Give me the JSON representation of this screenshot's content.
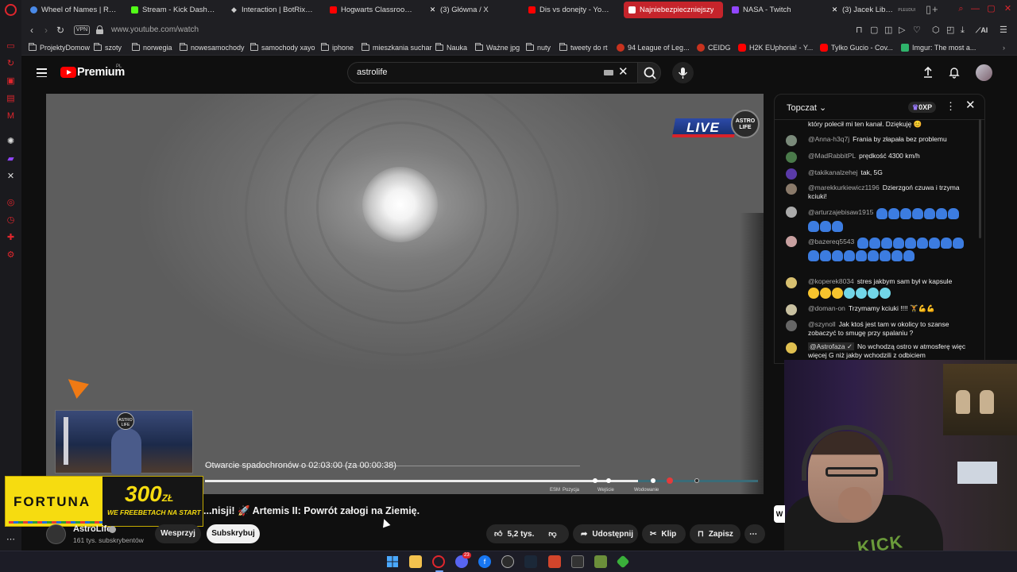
{
  "browser": {
    "tabs": [
      {
        "title": "Wheel of Names | Random",
        "icon": "wheel-icon",
        "color": "#4a8ae8"
      },
      {
        "title": "Stream - Kick Dashboard",
        "icon": "kick-icon",
        "color": "#53fc18"
      },
      {
        "title": "Interaction | BotRix — Cl",
        "icon": "botrix-icon",
        "color": "#cccccc"
      },
      {
        "title": "Hogwarts Classroom | Ha",
        "icon": "youtube-icon",
        "color": "#ff0000"
      },
      {
        "title": "(3) Główna / X",
        "icon": "x-icon",
        "color": "#ffffff"
      },
      {
        "title": "Dis vs donejty - YouTube",
        "icon": "youtube-icon",
        "color": "#ff0000"
      },
      {
        "title": "Najniebezpieczniejszy",
        "icon": "youtube-icon",
        "color": "#ffffff",
        "active": true
      },
      {
        "title": "NASA - Twitch",
        "icon": "twitch-icon",
        "color": "#9146ff"
      },
      {
        "title": "(3) Jacek Liberski",
        "icon": "x-icon",
        "color": "#ffffff"
      }
    ],
    "active_tab_badge": "PLEUDUI",
    "address": {
      "vpn_label": "VPN",
      "url": "www.youtube.com/watch",
      "ai_label": "AI"
    },
    "bookmarks": [
      {
        "label": "ProjektyDomow",
        "type": "folder"
      },
      {
        "label": "szoty",
        "type": "folder"
      },
      {
        "label": "norwegia",
        "type": "folder"
      },
      {
        "label": "nowesamochody",
        "type": "folder"
      },
      {
        "label": "samochody xayo",
        "type": "folder"
      },
      {
        "label": "iphone",
        "type": "folder"
      },
      {
        "label": "mieszkania suchar",
        "type": "folder"
      },
      {
        "label": "Nauka",
        "type": "folder"
      },
      {
        "label": "Ważne jpg",
        "type": "folder"
      },
      {
        "label": "nuty",
        "type": "folder"
      },
      {
        "label": "tweety do rt",
        "type": "folder"
      },
      {
        "label": "94 League of Leg...",
        "type": "site",
        "color": "#c8321e"
      },
      {
        "label": "CEIDG",
        "type": "site",
        "color": "#c8321e"
      },
      {
        "label": "H2K EUphoria! - Y...",
        "type": "site",
        "color": "#ff0000"
      },
      {
        "label": "Tylko Gucio - Cov...",
        "type": "site",
        "color": "#ff0000"
      },
      {
        "label": "Imgur: The most a...",
        "type": "site",
        "color": "#2fb36b"
      }
    ]
  },
  "youtube": {
    "logo_text": "Premium",
    "logo_region": "PL",
    "search_query": "astrolife",
    "video": {
      "live_label": "LIVE",
      "live_channel": "ASTRO LIFE",
      "inset_logo": "ASTRO LIFE",
      "countdown": "Otwarcie spadochronów o 02:03:00 (za 00:00:38)",
      "ticks": [
        {
          "label": "ESM",
          "position": 0.705
        },
        {
          "label": "Pozycja",
          "position": 0.73
        },
        {
          "label": "Wejście",
          "position": 0.81
        },
        {
          "label": "Wodowanie",
          "position": 0.875
        }
      ],
      "progress_fraction": 0.84,
      "title": "...nisji! 🚀 Artemis II: Powrót załogi na Ziemię."
    },
    "ad": {
      "brand": "FORTUNA",
      "amount": "300",
      "currency": "ZŁ",
      "subtitle": "WE FREEBETACH NA START"
    },
    "channel": {
      "name": "AstroLife",
      "subscribers": "161 tys. subskrybentów",
      "support_label": "Wesprzyj",
      "subscribe_label": "Subskrybuj"
    },
    "actions": {
      "likes": "5,2 tys.",
      "share": "Udostępnij",
      "clip": "Klip",
      "save": "Zapisz"
    },
    "chat": {
      "mode": "Topczat",
      "xp": "0XP",
      "messages": [
        {
          "author": "",
          "text": "który polecił mi ten kanał. Dziękuję 😊",
          "avatar": "#6b6b6b"
        },
        {
          "author": "@Anna-h3q7j",
          "text": "Frania by złapała bez problemu",
          "avatar": "#7a8a7a"
        },
        {
          "author": "@MadRabbitPL",
          "text": "prędkość 4300 km/h",
          "avatar": "#4a7a4a"
        },
        {
          "author": "@takikanalzehej",
          "text": "tak, 5G",
          "avatar": "#5a3aa8"
        },
        {
          "author": "@marekkurkiewicz1196",
          "text": "Dzierzgoń czuwa i trzyma kciuki!",
          "avatar": "#8a7a6a"
        },
        {
          "author": "@arturzajebisaw1915",
          "text": "",
          "avatar": "#aaa",
          "emoji": "blue",
          "count": 10
        },
        {
          "author": "@bazereq5543",
          "text": "",
          "avatar": "#c8a0a0",
          "emoji": "blue",
          "count": 18
        },
        {
          "author": "@koperek8034",
          "text": "stres jakbym sam był w kapsule",
          "avatar": "#d8c070",
          "emoji": "mixed",
          "count": 7
        },
        {
          "author": "@doman-on",
          "text": "Trzymamy kciuki !!!! 🏋💪💪",
          "avatar": "#c8c0a0"
        },
        {
          "author": "@szynoll",
          "text": "Jak ktoś jest tam w okolicy to szanse zobaczyć to smugę przy spalaniu ?",
          "avatar": "#666"
        },
        {
          "author": "@Astrofaza ✓",
          "text": "No wchodzą ostro w atmosferę więc więcej G niż jakby wchodzili z odbiciem",
          "avatar": "#e0c050",
          "owner": true
        }
      ]
    }
  },
  "colors": {
    "accent": "#e0262d",
    "yt_red": "#ff0000",
    "fortuna_yellow": "#f6dc10"
  },
  "taskbar": {
    "icons": [
      "windows-icon",
      "explorer-icon",
      "opera-icon",
      "discord-icon",
      "facebook-icon",
      "obs-icon",
      "steam-icon",
      "brave-icon",
      "terminal-icon",
      "minecraft-icon",
      "app-icon"
    ],
    "discord_badge": "23"
  },
  "overlay": {
    "webcam_hoodie_text": "KICK"
  }
}
